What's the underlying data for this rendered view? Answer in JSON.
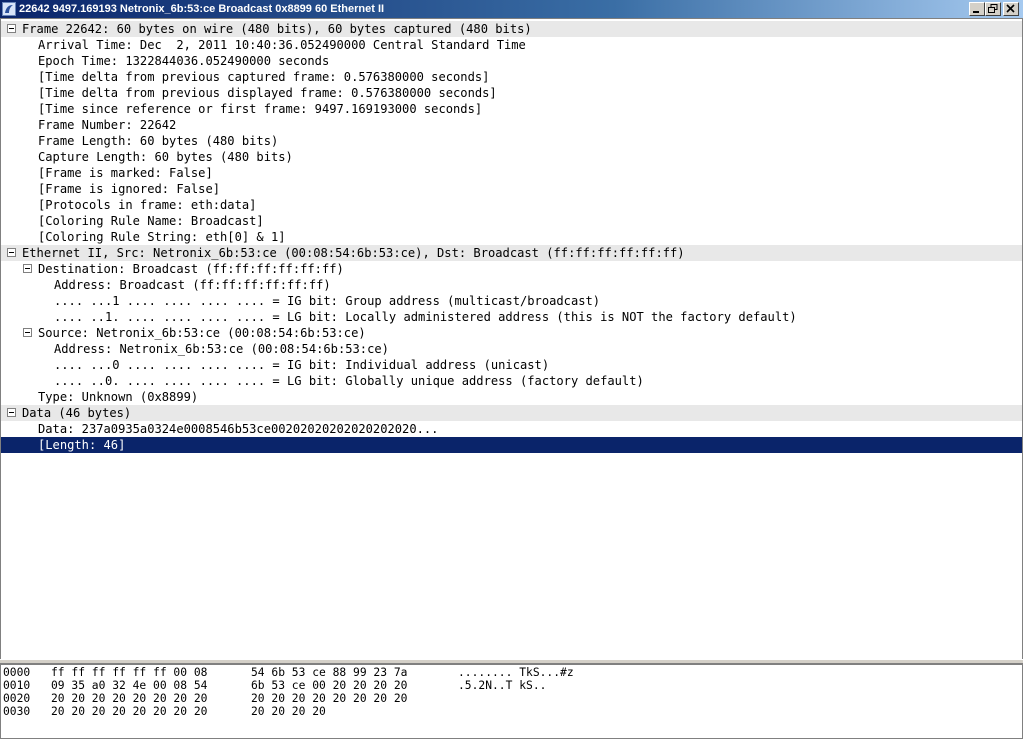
{
  "window": {
    "title": "22642 9497.169193 Netronix_6b:53:ce Broadcast 0x8899 60 Ethernet II"
  },
  "details": [
    {
      "text": "Frame 22642: 60 bytes on wire (480 bits), 60 bytes captured (480 bits)",
      "indent": 0,
      "expanded": true,
      "header": true
    },
    {
      "text": "Arrival Time: Dec  2, 2011 10:40:36.052490000 Central Standard Time",
      "indent": 1
    },
    {
      "text": "Epoch Time: 1322844036.052490000 seconds",
      "indent": 1
    },
    {
      "text": "[Time delta from previous captured frame: 0.576380000 seconds]",
      "indent": 1
    },
    {
      "text": "[Time delta from previous displayed frame: 0.576380000 seconds]",
      "indent": 1
    },
    {
      "text": "[Time since reference or first frame: 9497.169193000 seconds]",
      "indent": 1
    },
    {
      "text": "Frame Number: 22642",
      "indent": 1
    },
    {
      "text": "Frame Length: 60 bytes (480 bits)",
      "indent": 1
    },
    {
      "text": "Capture Length: 60 bytes (480 bits)",
      "indent": 1
    },
    {
      "text": "[Frame is marked: False]",
      "indent": 1
    },
    {
      "text": "[Frame is ignored: False]",
      "indent": 1
    },
    {
      "text": "[Protocols in frame: eth:data]",
      "indent": 1
    },
    {
      "text": "[Coloring Rule Name: Broadcast]",
      "indent": 1
    },
    {
      "text": "[Coloring Rule String: eth[0] & 1]",
      "indent": 1
    },
    {
      "text": "Ethernet II, Src: Netronix_6b:53:ce (00:08:54:6b:53:ce), Dst: Broadcast (ff:ff:ff:ff:ff:ff)",
      "indent": 0,
      "expanded": true,
      "header": true
    },
    {
      "text": "Destination: Broadcast (ff:ff:ff:ff:ff:ff)",
      "indent": 1,
      "expanded": true
    },
    {
      "text": "Address: Broadcast (ff:ff:ff:ff:ff:ff)",
      "indent": 2
    },
    {
      "text": ".... ...1 .... .... .... .... = IG bit: Group address (multicast/broadcast)",
      "indent": 2
    },
    {
      "text": ".... ..1. .... .... .... .... = LG bit: Locally administered address (this is NOT the factory default)",
      "indent": 2
    },
    {
      "text": "Source: Netronix_6b:53:ce (00:08:54:6b:53:ce)",
      "indent": 1,
      "expanded": true
    },
    {
      "text": "Address: Netronix_6b:53:ce (00:08:54:6b:53:ce)",
      "indent": 2
    },
    {
      "text": ".... ...0 .... .... .... .... = IG bit: Individual address (unicast)",
      "indent": 2
    },
    {
      "text": ".... ..0. .... .... .... .... = LG bit: Globally unique address (factory default)",
      "indent": 2
    },
    {
      "text": "Type: Unknown (0x8899)",
      "indent": 1
    },
    {
      "text": "Data (46 bytes)",
      "indent": 0,
      "expanded": true,
      "header": true
    },
    {
      "text": "Data: 237a0935a0324e0008546b53ce00202020202020202020...",
      "indent": 1
    },
    {
      "text": "[Length: 46]",
      "indent": 1,
      "selected": true
    }
  ],
  "bytes": [
    {
      "offset": "0000",
      "hex1": "ff ff ff ff ff ff 00 08",
      "hex2": "54 6b 53 ce 88 99 23 7a",
      "ascii": "........ TkS...#z"
    },
    {
      "offset": "0010",
      "hex1": "09 35 a0 32 4e 00 08 54",
      "hex2": "6b 53 ce 00 20 20 20 20",
      "ascii": ".5.2N..T kS..    "
    },
    {
      "offset": "0020",
      "hex1": "20 20 20 20 20 20 20 20",
      "hex2": "20 20 20 20 20 20 20 20",
      "ascii": ""
    },
    {
      "offset": "0030",
      "hex1": "20 20 20 20 20 20 20 20",
      "hex2": "20 20 20 20",
      "ascii": ""
    }
  ],
  "colors": {
    "selection": "#0a246a",
    "header_row": "#e8e8e8"
  }
}
